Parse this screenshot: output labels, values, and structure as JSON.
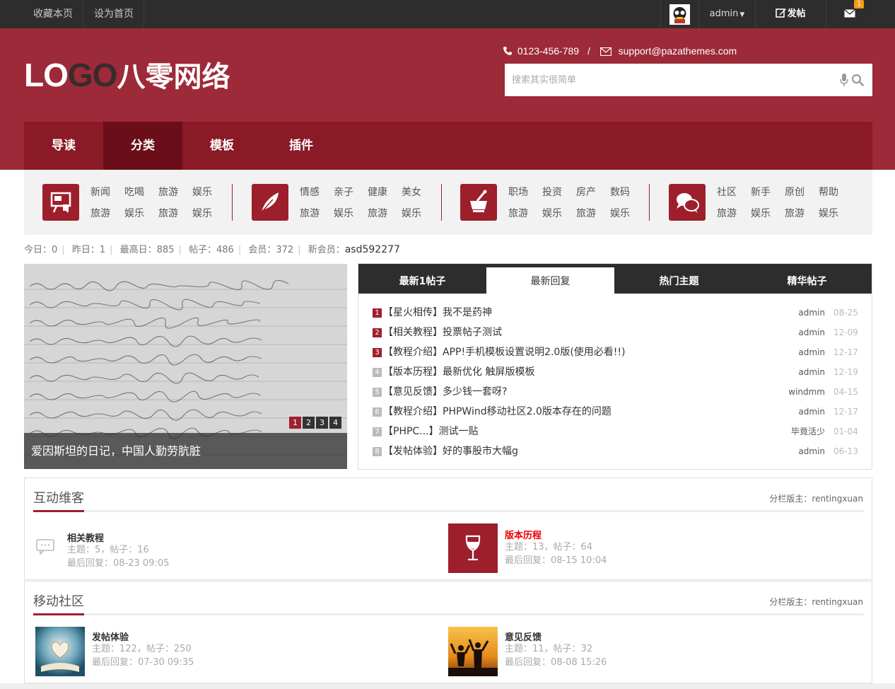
{
  "topbar": {
    "links": [
      "收藏本页",
      "设为首页"
    ],
    "user": "admin",
    "post_label": "发帖",
    "msg_count": "1"
  },
  "header": {
    "logo_prefix": "LO",
    "logo_go": "GO",
    "logo_cn": "八零网络",
    "phone": "0123-456-789",
    "separator": "/",
    "email": "support@pazathemes.com",
    "search_placeholder": "搜索其实很简单"
  },
  "nav": [
    "导读",
    "分类",
    "模板",
    "插件"
  ],
  "categories": [
    {
      "icon": "board-icon",
      "row1": [
        "新闻",
        "吃喝",
        "旅游",
        "娱乐"
      ],
      "row2": [
        "旅游",
        "娱乐",
        "旅游",
        "娱乐"
      ]
    },
    {
      "icon": "feather-icon",
      "row1": [
        "情感",
        "亲子",
        "健康",
        "美女"
      ],
      "row2": [
        "旅游",
        "娱乐",
        "旅游",
        "娱乐"
      ]
    },
    {
      "icon": "mortar-icon",
      "row1": [
        "职场",
        "投资",
        "房产",
        "数码"
      ],
      "row2": [
        "旅游",
        "娱乐",
        "旅游",
        "娱乐"
      ]
    },
    {
      "icon": "chat-icon",
      "row1": [
        "社区",
        "新手",
        "原创",
        "帮助"
      ],
      "row2": [
        "旅游",
        "娱乐",
        "旅游",
        "娱乐"
      ]
    }
  ],
  "stats": {
    "today": "今日：0",
    "yesterday": "昨日：1",
    "max": "最高日：885",
    "posts": "帖子：486",
    "members": "会员：372",
    "new_member_label": "新会员：",
    "new_member": "asd592277"
  },
  "slider": {
    "caption": "爱因斯坦的日记，中国人勤劳肮脏",
    "pages": [
      "1",
      "2",
      "3",
      "4"
    ]
  },
  "tabs": [
    "最新1帖子",
    "最新回复",
    "热门主题",
    "精华帖子"
  ],
  "threads": [
    {
      "num": "1",
      "title": "【星火相传】我不是药神",
      "author": "admin",
      "date": "08-25"
    },
    {
      "num": "2",
      "title": "【相关教程】投票帖子测试",
      "author": "admin",
      "date": "12-09"
    },
    {
      "num": "3",
      "title": "【教程介绍】APP!手机模板设置说明2.0版(使用必看!!)",
      "author": "admin",
      "date": "12-17"
    },
    {
      "num": "4",
      "title": "【版本历程】最新优化 触屏版模板",
      "author": "admin",
      "date": "12-19"
    },
    {
      "num": "5",
      "title": "【意见反馈】多少钱一套呀?",
      "author": "windmm",
      "date": "04-15"
    },
    {
      "num": "6",
      "title": "【教程介绍】PHPWind移动社区2.0版本存在的问题",
      "author": "admin",
      "date": "12-17"
    },
    {
      "num": "7",
      "title": "【PHPC...】测试一贴",
      "author": "毕竟活少",
      "date": "01-04"
    },
    {
      "num": "8",
      "title": "【发帖体验】好的事股市大幅g",
      "author": "admin",
      "date": "06-13"
    }
  ],
  "sections": [
    {
      "title": "互动维客",
      "moderator": "分栏版主：rentingxuan",
      "forums": [
        {
          "name": "相关教程",
          "meta1": "主题：5，帖子：16",
          "meta2": "最后回复：08-23 09:05"
        },
        {
          "name": "版本历程",
          "meta1": "主题：13，帖子：64",
          "meta2": "最后回复：08-15 10:04"
        }
      ]
    },
    {
      "title": "移动社区",
      "moderator": "分栏版主：rentingxuan",
      "forums": [
        {
          "name": "发帖体验",
          "meta1": "主题：122，帖子：250",
          "meta2": "最后回复：07-30 09:35"
        },
        {
          "name": "意见反馈",
          "meta1": "主题：11，帖子：32",
          "meta2": "最后回复：08-08 15:26"
        }
      ]
    }
  ],
  "colors": {
    "brand": "#9d2a38",
    "nav": "#8a1a26",
    "nav_active": "#6a0f1a",
    "topbar": "#2d2d2d"
  }
}
